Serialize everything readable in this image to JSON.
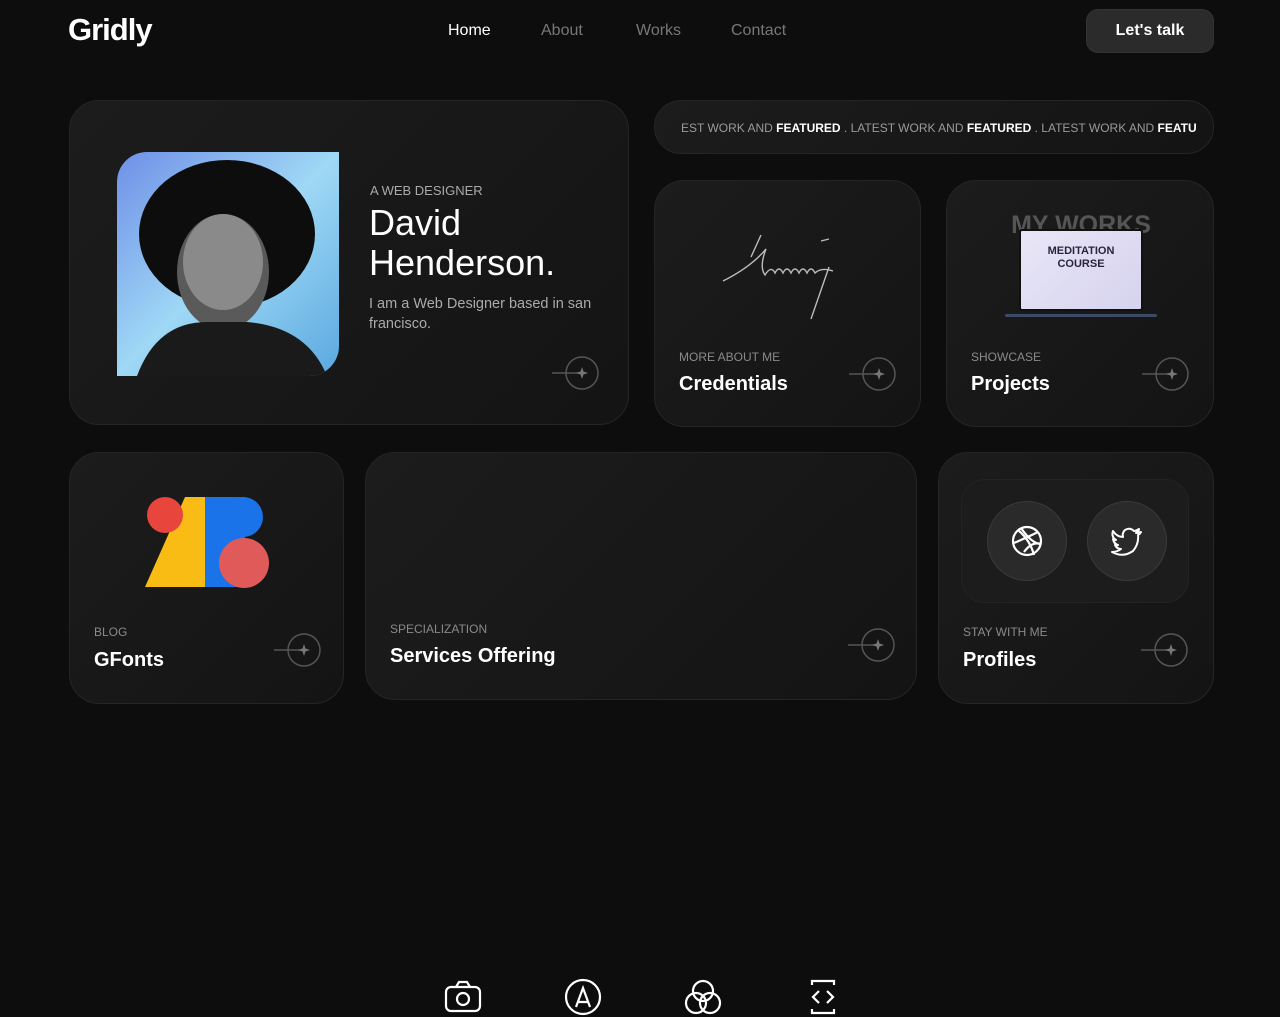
{
  "header": {
    "logo": "Gridly",
    "nav": [
      "Home",
      "About",
      "Works",
      "Contact"
    ],
    "cta": "Let's talk"
  },
  "profile": {
    "eyebrow": "A WEB DESIGNER",
    "name_line1": "David",
    "name_line2": "Henderson.",
    "bio": "I am a Web Designer based in san francisco."
  },
  "marquee": {
    "items": [
      {
        "text": "EST WORK AND ",
        "bold": "FEATURED"
      },
      {
        "text": " . LATEST WORK AND ",
        "bold": "FEATURED"
      },
      {
        "text": " . LATEST WORK AND ",
        "bold": "FEATU"
      }
    ]
  },
  "cards": {
    "credentials": {
      "label": "MORE ABOUT ME",
      "title": "Credentials"
    },
    "projects": {
      "label": "SHOWCASE",
      "title": "Projects",
      "thumb_heading": "MY WORKS",
      "thumb_screen": "MEDITATION COURSE"
    },
    "blog": {
      "label": "BLOG",
      "title": "GFonts"
    },
    "services": {
      "label": "SPECIALIZATION",
      "title": "Services Offering",
      "icons": [
        "camera-icon",
        "pen-tool-icon",
        "color-circles-icon",
        "code-phone-icon"
      ]
    },
    "profiles": {
      "label": "STAY WITH ME",
      "title": "Profiles",
      "icons": [
        "dribbble-icon",
        "twitter-icon"
      ]
    }
  },
  "colors": {
    "background": "#0d0d0d",
    "card": "#181818",
    "accent_red": "#e8453c",
    "accent_yellow": "#f9bc15",
    "accent_blue": "#1a73e8"
  }
}
